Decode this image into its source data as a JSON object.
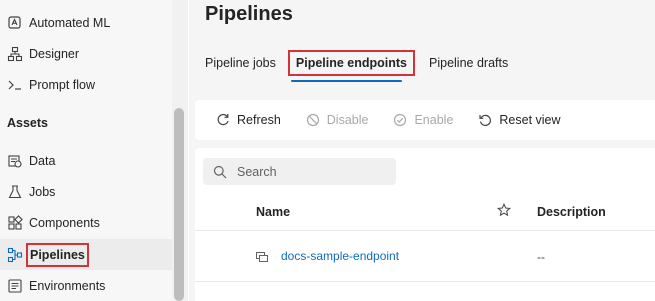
{
  "sidebar": {
    "items_top": [
      {
        "label": "Automated ML",
        "icon": "automated-ml-icon"
      },
      {
        "label": "Designer",
        "icon": "designer-icon"
      },
      {
        "label": "Prompt flow",
        "icon": "prompt-flow-icon"
      }
    ],
    "section_title": "Assets",
    "items_assets": [
      {
        "label": "Data",
        "icon": "data-icon"
      },
      {
        "label": "Jobs",
        "icon": "jobs-flask-icon"
      },
      {
        "label": "Components",
        "icon": "components-icon"
      },
      {
        "label": "Pipelines",
        "icon": "pipelines-icon",
        "active": true
      },
      {
        "label": "Environments",
        "icon": "environments-icon"
      }
    ]
  },
  "page": {
    "title": "Pipelines",
    "tabs": [
      {
        "label": "Pipeline jobs"
      },
      {
        "label": "Pipeline endpoints",
        "active": true
      },
      {
        "label": "Pipeline drafts"
      }
    ]
  },
  "toolbar": {
    "refresh": "Refresh",
    "disable": "Disable",
    "enable": "Enable",
    "reset_view": "Reset view"
  },
  "search": {
    "placeholder": "Search",
    "value": ""
  },
  "table": {
    "columns": {
      "name": "Name",
      "description": "Description"
    },
    "rows": [
      {
        "name": "docs-sample-endpoint",
        "description": "--"
      }
    ]
  },
  "colors": {
    "accent": "#0f6cbd",
    "highlight": "#d13438"
  }
}
